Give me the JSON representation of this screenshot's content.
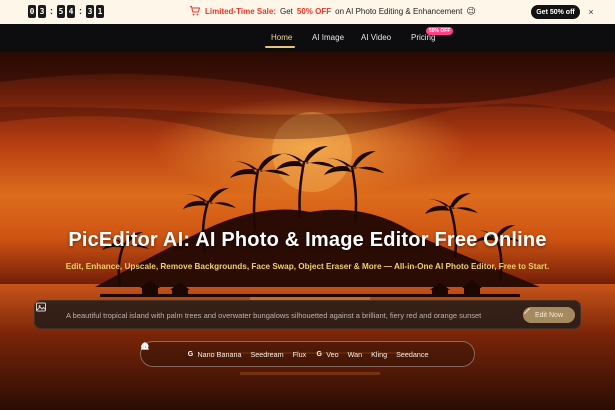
{
  "promo": {
    "timer": [
      "0",
      "3",
      "5",
      "4",
      "3",
      "1"
    ],
    "sale_label": "Limited-Time Sale:",
    "text_before": "Get",
    "percent": "50% OFF",
    "text_after": "on AI Photo Editing & Enhancement",
    "emoji": "😉",
    "button": "Get 50% off",
    "close": "×"
  },
  "nav": {
    "items": [
      "Home",
      "AI Image",
      "AI Video",
      "Pricing"
    ],
    "active": "Home",
    "pricing_badge": "50% OFF"
  },
  "hero": {
    "title": "PicEditor AI: AI Photo & Image Editor Free Online",
    "subtitle": "Edit, Enhance, Upscale, Remove Backgrounds, Face Swap, Object Eraser & More — All-in-One AI Photo Editor, Free to Start."
  },
  "prompt": {
    "text": "A beautiful tropical island with palm trees and overwater bungalows silhouetted against a brilliant, fiery red and orange sunset",
    "button": "Edit Now"
  },
  "models": [
    {
      "name": "Nano Banana",
      "icon": "google-icon"
    },
    {
      "name": "Seedream",
      "icon": "seedream-icon"
    },
    {
      "name": "Flux",
      "icon": "flux-icon"
    },
    {
      "name": "Veo",
      "icon": "google-icon"
    },
    {
      "name": "Wan",
      "icon": "wan-icon"
    },
    {
      "name": "Kling",
      "icon": "kling-icon"
    },
    {
      "name": "Seedance",
      "icon": "seedance-icon"
    }
  ],
  "colors": {
    "accent_gold": "#f2cf6d",
    "sale_red": "#e5372a",
    "badge_pink": "#ff3f87",
    "edit_button": "#a58a5f"
  }
}
